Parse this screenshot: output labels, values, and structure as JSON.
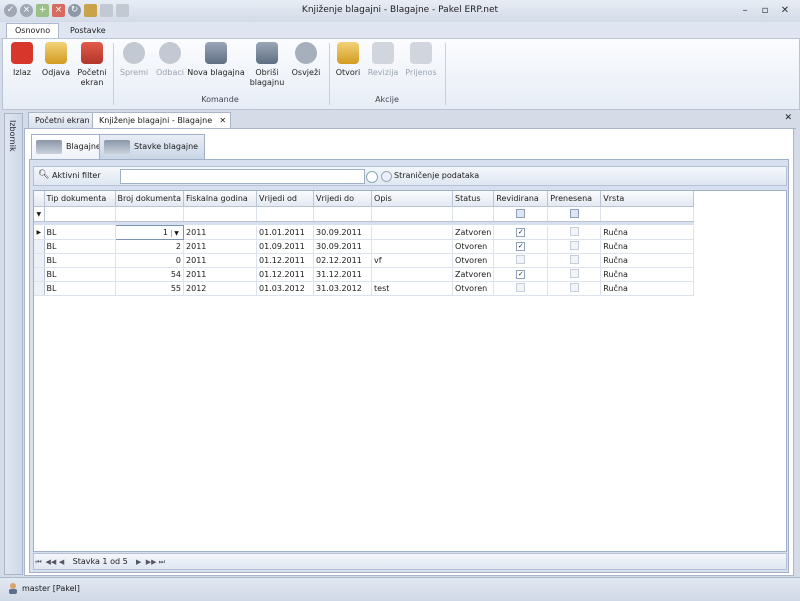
{
  "window": {
    "title": "Knjiženje blagajni - Blagajne - Pakel ERP.net"
  },
  "ribbon_tabs": [
    "Osnovno",
    "Postavke"
  ],
  "ribbon": {
    "buttons": {
      "izlaz": "Izlaz",
      "odjava": "Odjava",
      "pocetni_ekran_1": "Početni",
      "pocetni_ekran_2": "ekran",
      "spremi": "Spremi",
      "odbaci": "Odbaci",
      "nova_blagajna": "Nova blagajna",
      "obrisi_1": "Obriši",
      "obrisi_2": "blagajnu",
      "osvjezi": "Osvježi",
      "otvori": "Otvori",
      "revizija": "Revizija",
      "prijenos": "Prijenos"
    },
    "groups": {
      "komande": "Komande",
      "akcije": "Akcije"
    }
  },
  "sidebar": {
    "label": "Izbornik"
  },
  "doc_tabs": [
    "Početni ekran",
    "Knjiženje blagajni - Blagajne"
  ],
  "sub_tabs": [
    "Blagajne",
    "Stavke blagajne"
  ],
  "filter": {
    "label": "Aktivni filter",
    "value": "",
    "paging_label": "Straničenje podataka"
  },
  "grid": {
    "columns": [
      "Tip dokumenta",
      "Broj dokumenta",
      "Fiskalna godina",
      "Vrijedi od",
      "Vrijedi do",
      "Opis",
      "Status",
      "Revidirana",
      "Prenesena",
      "Vrsta"
    ],
    "rows": [
      {
        "tip": "BL",
        "broj": "1",
        "godina": "2011",
        "od": "01.01.2011",
        "do": "30.09.2011",
        "opis": "",
        "status": "Zatvoren",
        "revidirana": true,
        "prenesena": false,
        "vrsta": "Ručna"
      },
      {
        "tip": "BL",
        "broj": "2",
        "godina": "2011",
        "od": "01.09.2011",
        "do": "30.09.2011",
        "opis": "",
        "status": "Otvoren",
        "revidirana": true,
        "prenesena": false,
        "vrsta": "Ručna"
      },
      {
        "tip": "BL",
        "broj": "0",
        "godina": "2011",
        "od": "01.12.2011",
        "do": "02.12.2011",
        "opis": "vf",
        "status": "Otvoren",
        "revidirana": false,
        "prenesena": false,
        "vrsta": "Ručna"
      },
      {
        "tip": "BL",
        "broj": "54",
        "godina": "2011",
        "od": "01.12.2011",
        "do": "31.12.2011",
        "opis": "",
        "status": "Zatvoren",
        "revidirana": true,
        "prenesena": false,
        "vrsta": "Ručna"
      },
      {
        "tip": "BL",
        "broj": "55",
        "godina": "2012",
        "od": "01.03.2012",
        "do": "31.03.2012",
        "opis": "test",
        "status": "Otvoren",
        "revidirana": false,
        "prenesena": false,
        "vrsta": "Ručna"
      }
    ]
  },
  "navigator": {
    "record_text": "Stavka 1 od 5"
  },
  "status": {
    "user": "master [Pakel]"
  },
  "colors": {
    "accent": "#3d6bb3",
    "red": "#d9362b",
    "ribbon_bg": "#e7edf6"
  }
}
